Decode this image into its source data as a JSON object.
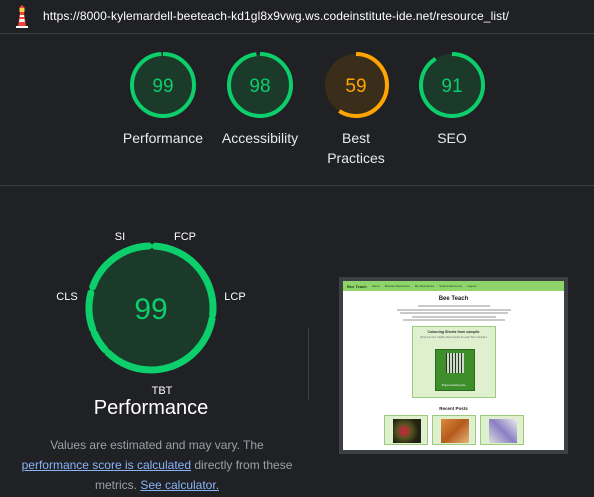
{
  "address_bar": {
    "url": "https://8000-kylemardell-beeteach-kd1gl8x9vwg.ws.codeinstitute-ide.net/resource_list/"
  },
  "scores": [
    {
      "value": "99",
      "label": "Performance",
      "score": 99,
      "status": "pass",
      "color": "#0cce6b"
    },
    {
      "value": "98",
      "label": "Accessibility",
      "score": 98,
      "status": "pass",
      "color": "#0cce6b"
    },
    {
      "value": "59",
      "label": "Best Practices",
      "score": 59,
      "status": "average",
      "color": "#ffa400"
    },
    {
      "value": "91",
      "label": "SEO",
      "score": 91,
      "status": "pass",
      "color": "#0cce6b"
    }
  ],
  "performance": {
    "score": "99",
    "title": "Performance",
    "metrics": [
      "SI",
      "FCP",
      "LCP",
      "TBT",
      "CLS"
    ],
    "note_text": "Values are estimated and may vary. The",
    "note_link1": "performance score is calculated",
    "note_middle": "directly from these metrics.",
    "note_link2": "See calculator."
  },
  "screenshot": {
    "brand": "Bee Teach",
    "nav": [
      "Home",
      "Browse Resources",
      "My Resources",
      "Submit Resource",
      "Logout"
    ],
    "heading": "Bee Teach",
    "card_title": "Colouring Sheets from compile",
    "card_sub": "(Find out Lime notably shared today for each ‘Bee Compile’)",
    "card_caption": "Project colouring she...",
    "recent_title": "Recent Posts"
  },
  "colors": {
    "pass": "#0cce6b",
    "average": "#ffa400",
    "background": "#202124",
    "link": "#8ab4f8"
  }
}
